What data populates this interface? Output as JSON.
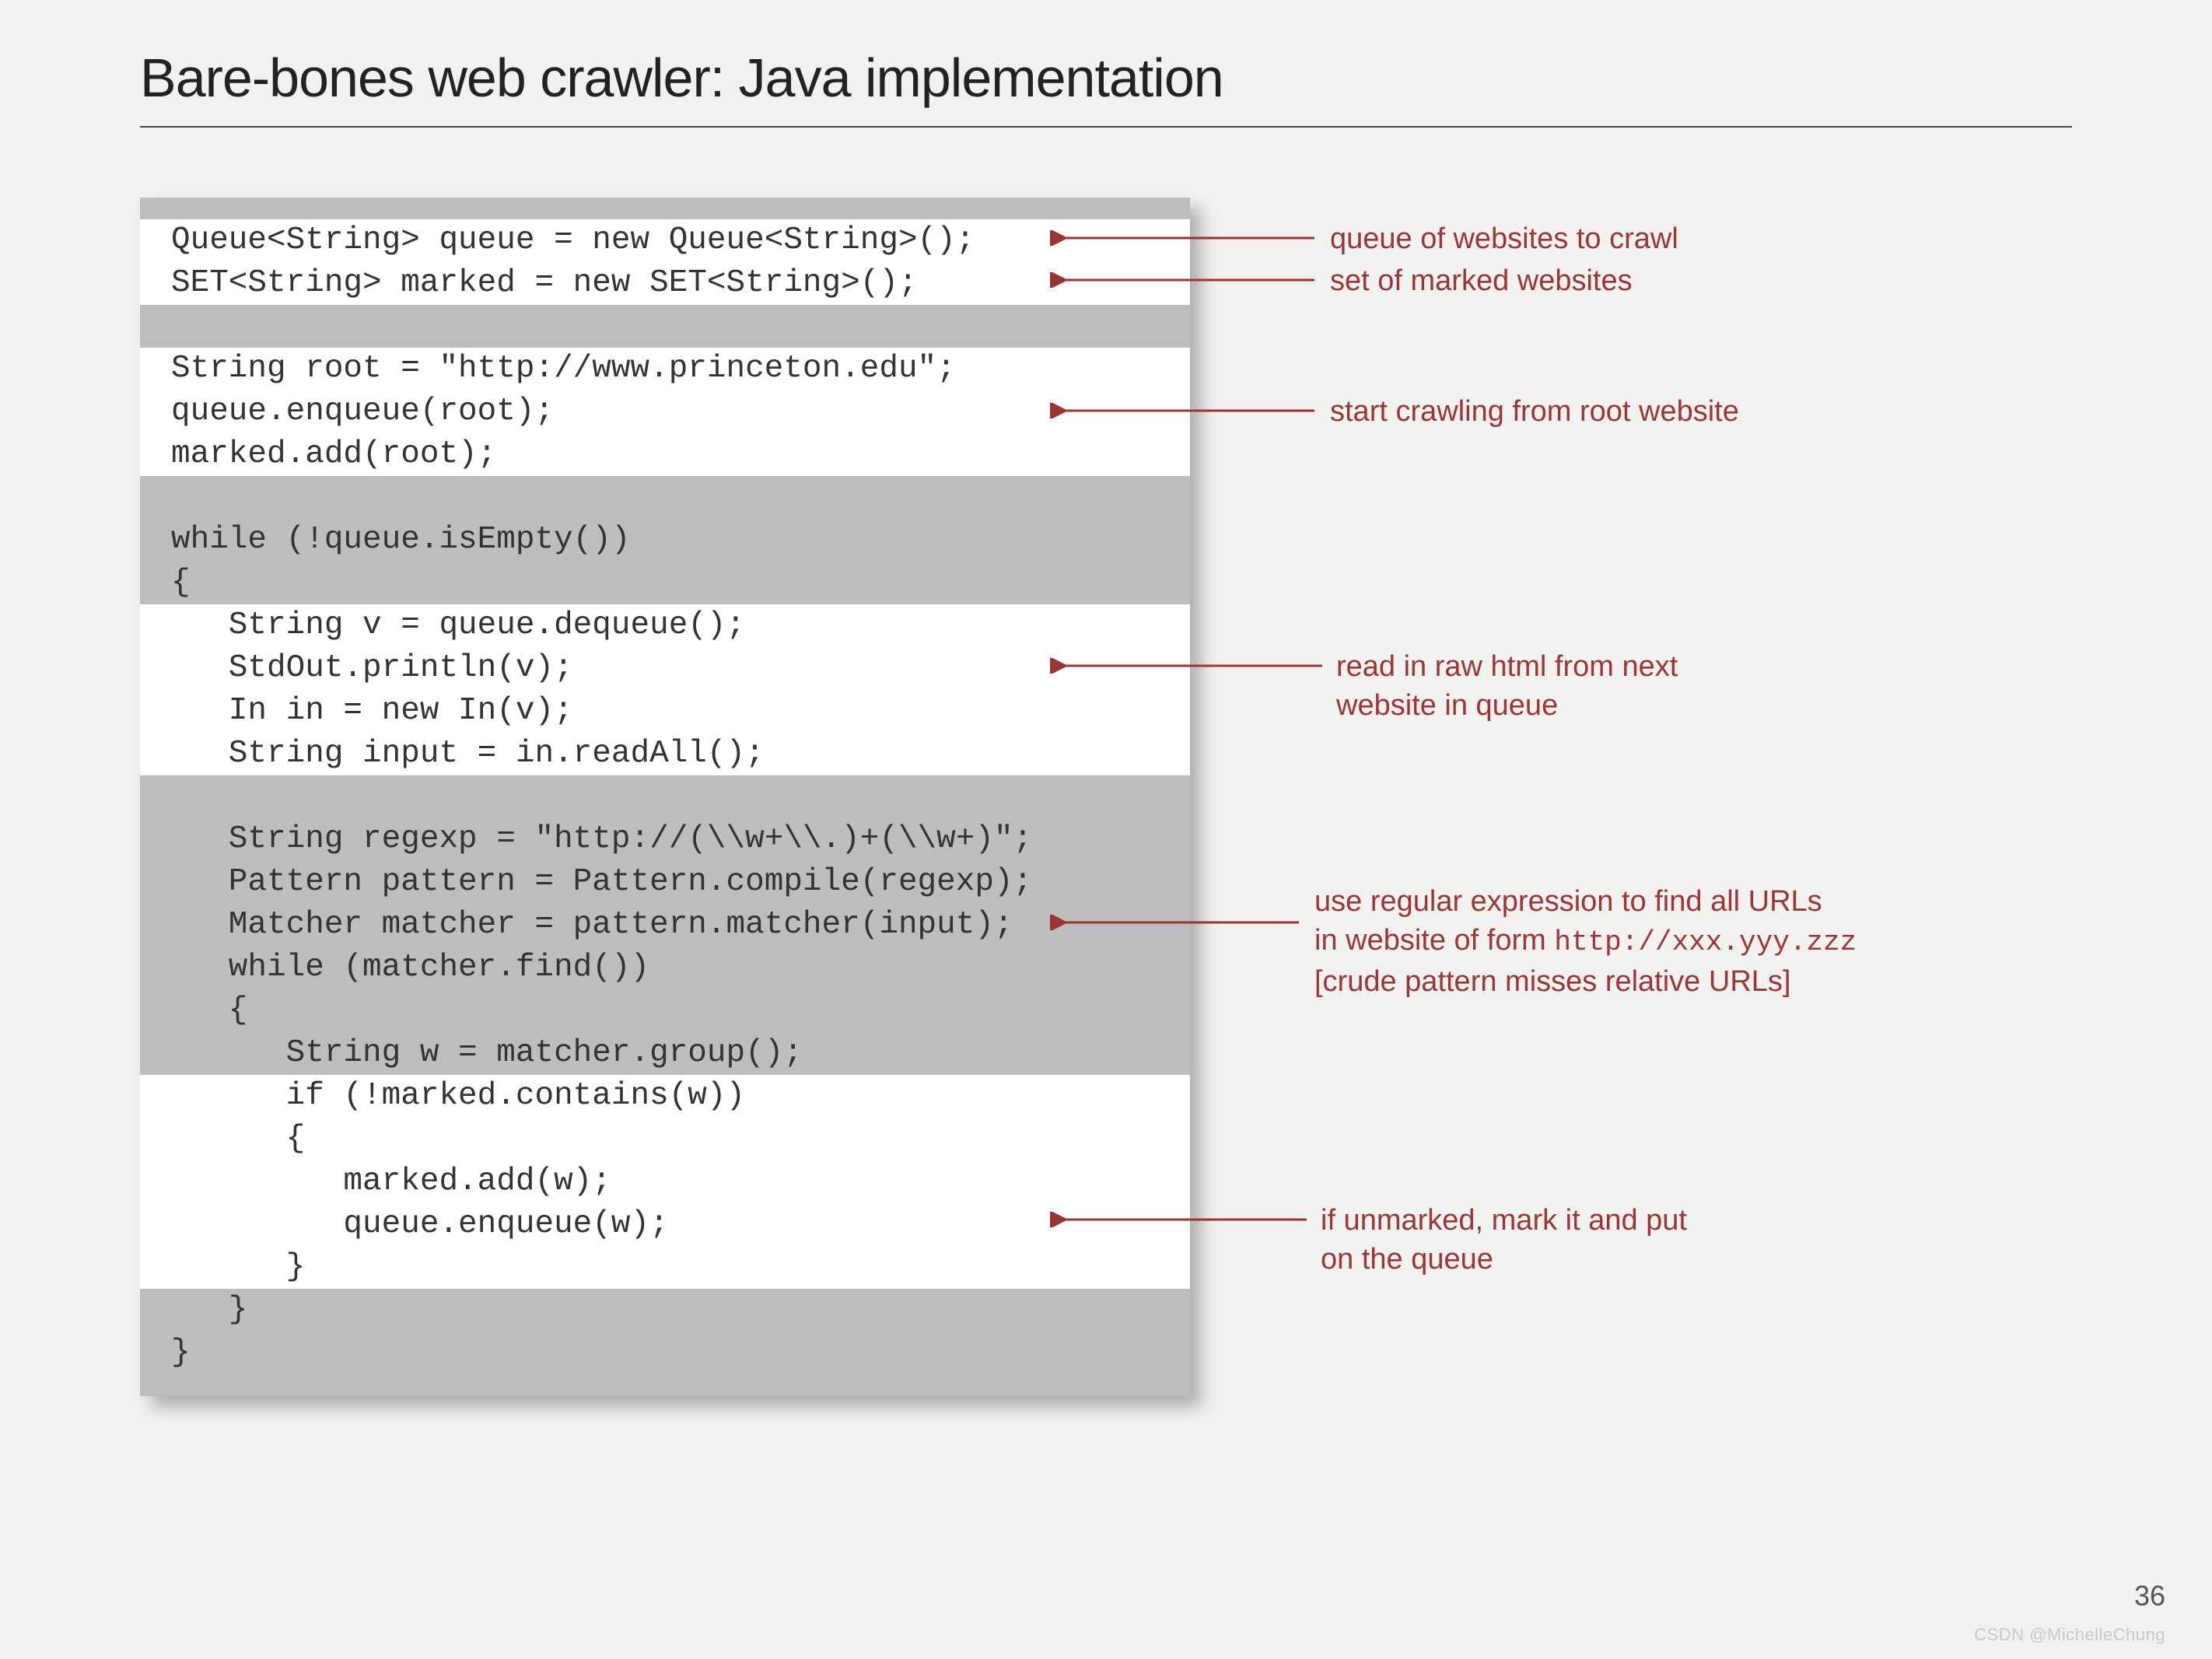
{
  "title": "Bare-bones web crawler:  Java implementation",
  "code_lines": [
    {
      "t": "Queue<String> queue = new Queue<String>();",
      "hl": true,
      "indent": 0
    },
    {
      "t": "SET<String> marked = new SET<String>();",
      "hl": true,
      "indent": 0
    },
    {
      "t": "",
      "hl": false,
      "indent": 0
    },
    {
      "t": "String root = \"http://www.princeton.edu\";",
      "hl": true,
      "indent": 0
    },
    {
      "t": "queue.enqueue(root);",
      "hl": true,
      "indent": 0
    },
    {
      "t": "marked.add(root);",
      "hl": true,
      "indent": 0
    },
    {
      "t": "",
      "hl": false,
      "indent": 0
    },
    {
      "t": "while (!queue.isEmpty())",
      "hl": false,
      "indent": 0
    },
    {
      "t": "{",
      "hl": false,
      "indent": 0
    },
    {
      "t": "String v = queue.dequeue();",
      "hl": true,
      "indent": 1
    },
    {
      "t": "StdOut.println(v);",
      "hl": true,
      "indent": 1
    },
    {
      "t": "In in = new In(v);",
      "hl": true,
      "indent": 1
    },
    {
      "t": "String input = in.readAll();",
      "hl": true,
      "indent": 1
    },
    {
      "t": "",
      "hl": false,
      "indent": 0
    },
    {
      "t": "String regexp = \"http://(\\\\w+\\\\.)+(\\\\w+)\";",
      "hl": false,
      "indent": 1
    },
    {
      "t": "Pattern pattern = Pattern.compile(regexp);",
      "hl": false,
      "indent": 1
    },
    {
      "t": "Matcher matcher = pattern.matcher(input);",
      "hl": false,
      "indent": 1
    },
    {
      "t": "while (matcher.find())",
      "hl": false,
      "indent": 1
    },
    {
      "t": "{",
      "hl": false,
      "indent": 1
    },
    {
      "t": "String w = matcher.group();",
      "hl": false,
      "indent": 2
    },
    {
      "t": "if (!marked.contains(w))",
      "hl": true,
      "indent": 2
    },
    {
      "t": "{",
      "hl": true,
      "indent": 2
    },
    {
      "t": "marked.add(w);",
      "hl": true,
      "indent": 3
    },
    {
      "t": "queue.enqueue(w);",
      "hl": true,
      "indent": 3
    },
    {
      "t": "}",
      "hl": true,
      "indent": 2
    },
    {
      "t": "}",
      "hl": false,
      "indent": 1
    },
    {
      "t": "}",
      "hl": false,
      "indent": 0
    }
  ],
  "annotations": {
    "a1": "queue of websites to crawl",
    "a2": "set of marked websites",
    "a3": "start crawling from root website",
    "a4_l1": "read in raw html from next",
    "a4_l2": "website in queue",
    "a5_l1": "use regular expression to find all URLs",
    "a5_l2_pre": "in website of form ",
    "a5_l2_mono": "http://xxx.yyy.zzz",
    "a5_l3": "[crude pattern misses relative URLs]",
    "a6_l1": "if unmarked, mark it and put",
    "a6_l2": "on the queue"
  },
  "page_number": "36",
  "watermark": "CSDN @MichelleChung"
}
